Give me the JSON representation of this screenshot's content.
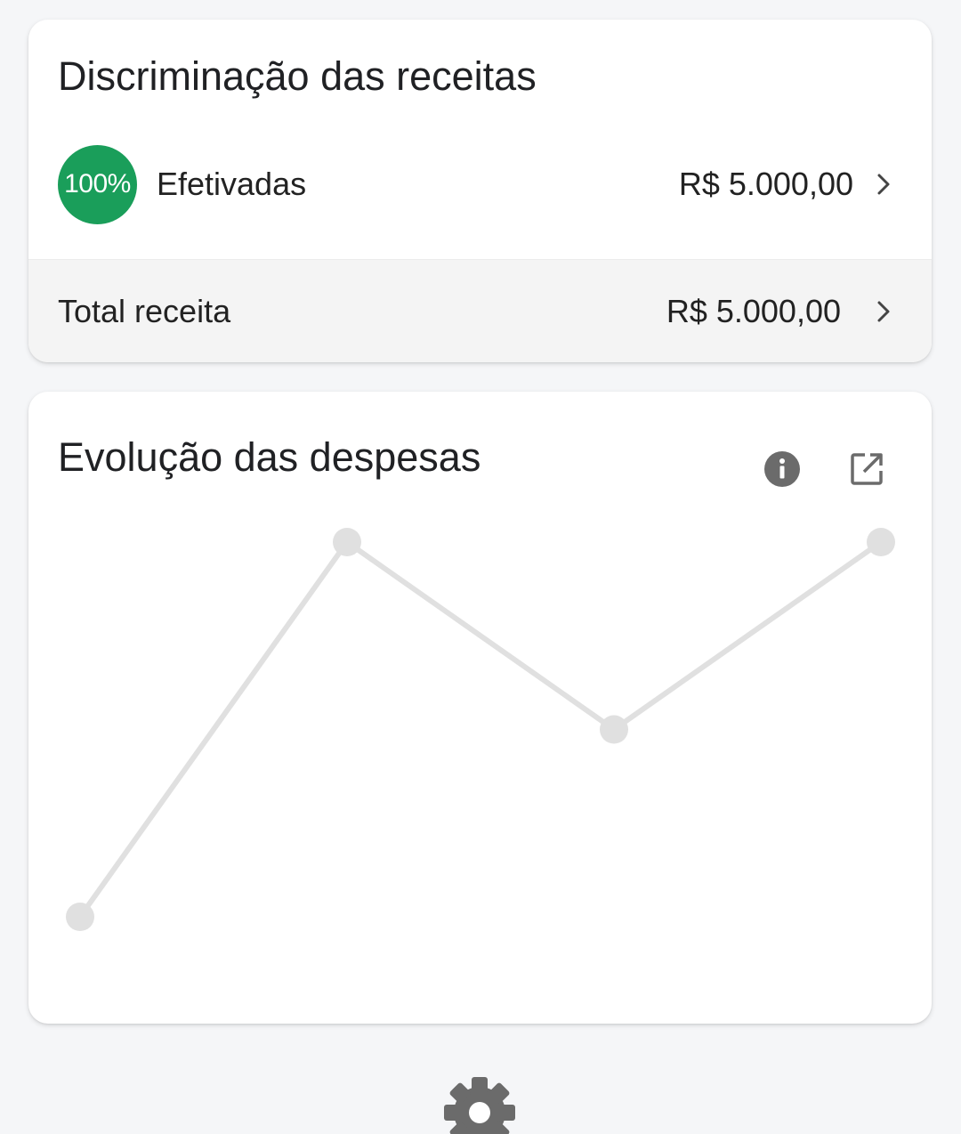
{
  "income_breakdown": {
    "title": "Discriminação das receitas",
    "effective": {
      "percent": "100%",
      "label": "Efetivadas",
      "value": "R$ 5.000,00",
      "badge_color": "#1a9e5a"
    },
    "total": {
      "label": "Total receita",
      "value": "R$ 5.000,00"
    },
    "icons": {
      "row_chevron": "chevron-right-icon"
    }
  },
  "expense_evolution": {
    "title": "Evolução das despesas",
    "icons": {
      "info": "info-icon",
      "open": "open-in-new-icon"
    },
    "line_color": "#e0e0e0"
  },
  "chart_data": {
    "type": "line",
    "title": "Evolução das despesas",
    "x": [
      1,
      2,
      3,
      4
    ],
    "series": [
      {
        "values": [
          0,
          2,
          1,
          2
        ]
      }
    ],
    "ylim": [
      0,
      2
    ],
    "grid": false,
    "legend": "none"
  },
  "footer": {
    "settings_icon": "gear-icon"
  }
}
